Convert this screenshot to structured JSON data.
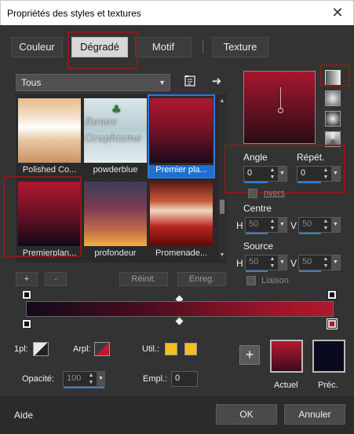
{
  "window": {
    "title": "Propriétés des styles et textures",
    "close_glyph": "✕"
  },
  "tabs": [
    "Couleur",
    "Dégradé",
    "Motif",
    "Texture"
  ],
  "active_tab": "Dégradé",
  "gallery": {
    "category": "Tous",
    "items": [
      {
        "label": "Polished Co...",
        "selected": false
      },
      {
        "label": "powderblue",
        "selected": false
      },
      {
        "label": "Premier pla...",
        "selected": true
      },
      {
        "label": "Premierplan...",
        "selected": false
      },
      {
        "label": "profondeur",
        "selected": false
      },
      {
        "label": "Promenade...",
        "selected": false
      }
    ]
  },
  "watermark": {
    "line1": "Renee",
    "line2": "Graphisme"
  },
  "edit_buttons": {
    "add": "+",
    "remove": "-",
    "reset": "Réinit.",
    "save": "Enreg."
  },
  "angle": {
    "label": "Angle",
    "value": "0"
  },
  "repeat": {
    "label": "Répét.",
    "value": "0"
  },
  "invert": {
    "label": "Inverser",
    "visible_label": "nvers",
    "checked": false
  },
  "centre": {
    "label": "Centre",
    "h_label": "H",
    "h": "50",
    "v_label": "V",
    "v": "50"
  },
  "source": {
    "label": "Source",
    "h_label": "H",
    "h": "50",
    "v_label": "V",
    "v": "50"
  },
  "link": {
    "label": "Liaison",
    "checked": false
  },
  "bottom": {
    "pl1_label": "1pl:",
    "arpl_label": "Arpl:",
    "util_label": "Util.:",
    "opacity_label": "Opacité:",
    "opacity_value": "100",
    "empl_label": "Empl.:",
    "empl_value": "0",
    "current_label": "Actuel",
    "previous_label": "Préc."
  },
  "footer": {
    "help": "Aide",
    "ok": "OK",
    "cancel": "Annuler"
  },
  "colors": {
    "dialog_bg": "#333333",
    "accent": "#1f6fd1",
    "highlight_box": "#8b1a1a",
    "gradient_start": "#14091a",
    "gradient_end": "#b0182c",
    "current_color_top": "#b3182f",
    "current_color_bottom": "#3a0a18",
    "previous_color": "#0a0a1e",
    "util_yellow": "#f4c021"
  },
  "icons": {
    "close": "close-icon",
    "tool": "document-tool-icon",
    "arrow": "arrow-right-icon",
    "plus": "plus-icon"
  }
}
